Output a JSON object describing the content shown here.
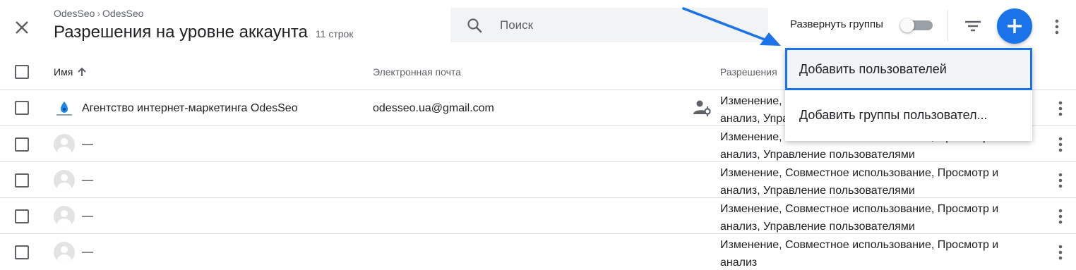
{
  "header": {
    "breadcrumb": [
      "OdesSeo",
      "OdesSeo"
    ],
    "breadcrumb_separator": "›",
    "title": "Разрешения на уровне аккаунта",
    "row_count": "11 строк",
    "search_placeholder": "Поиск",
    "expand_groups_label": "Развернуть группы",
    "expand_groups_on": false
  },
  "table": {
    "columns": {
      "name": "Имя",
      "email": "Электронная почта",
      "permissions": "Разрешения"
    },
    "rows": [
      {
        "name": "Агентство интернет-маркетинга OdesSeo",
        "email": "odesseo.ua@gmail.com",
        "permissions": "Изменение, Совместное использование, Просмотр и анализ, Управление пользователями",
        "avatar": "odesseo-logo",
        "user-admin-icon": true
      },
      {
        "name": "—",
        "email": "",
        "permissions": "Изменение, Совместное использование, Просмотр и анализ, Управление пользователями",
        "avatar": "default-avatar"
      },
      {
        "name": "—",
        "email": "",
        "permissions": "Изменение, Совместное использование, Просмотр и анализ, Управление пользователями",
        "avatar": "default-avatar"
      },
      {
        "name": "—",
        "email": "",
        "permissions": "Изменение, Совместное использование, Просмотр и анализ, Управление пользователями",
        "avatar": "default-avatar"
      },
      {
        "name": "—",
        "email": "",
        "permissions": "Изменение, Совместное использование, Просмотр и анализ",
        "avatar": "default-avatar"
      }
    ]
  },
  "menu": {
    "items": [
      "Добавить пользователей",
      "Добавить группы пользовател..."
    ]
  },
  "colors": {
    "accent": "#1a73e8",
    "text": "#202124",
    "secondary_text": "#5f6368",
    "divider": "#dadce0",
    "search_bg": "#f1f3f4"
  },
  "icons": [
    "close-icon",
    "search-icon",
    "filter-icon",
    "plus-icon",
    "more-vert-icon",
    "arrow-up-icon",
    "user-admin-icon",
    "odesseo-logo"
  ]
}
